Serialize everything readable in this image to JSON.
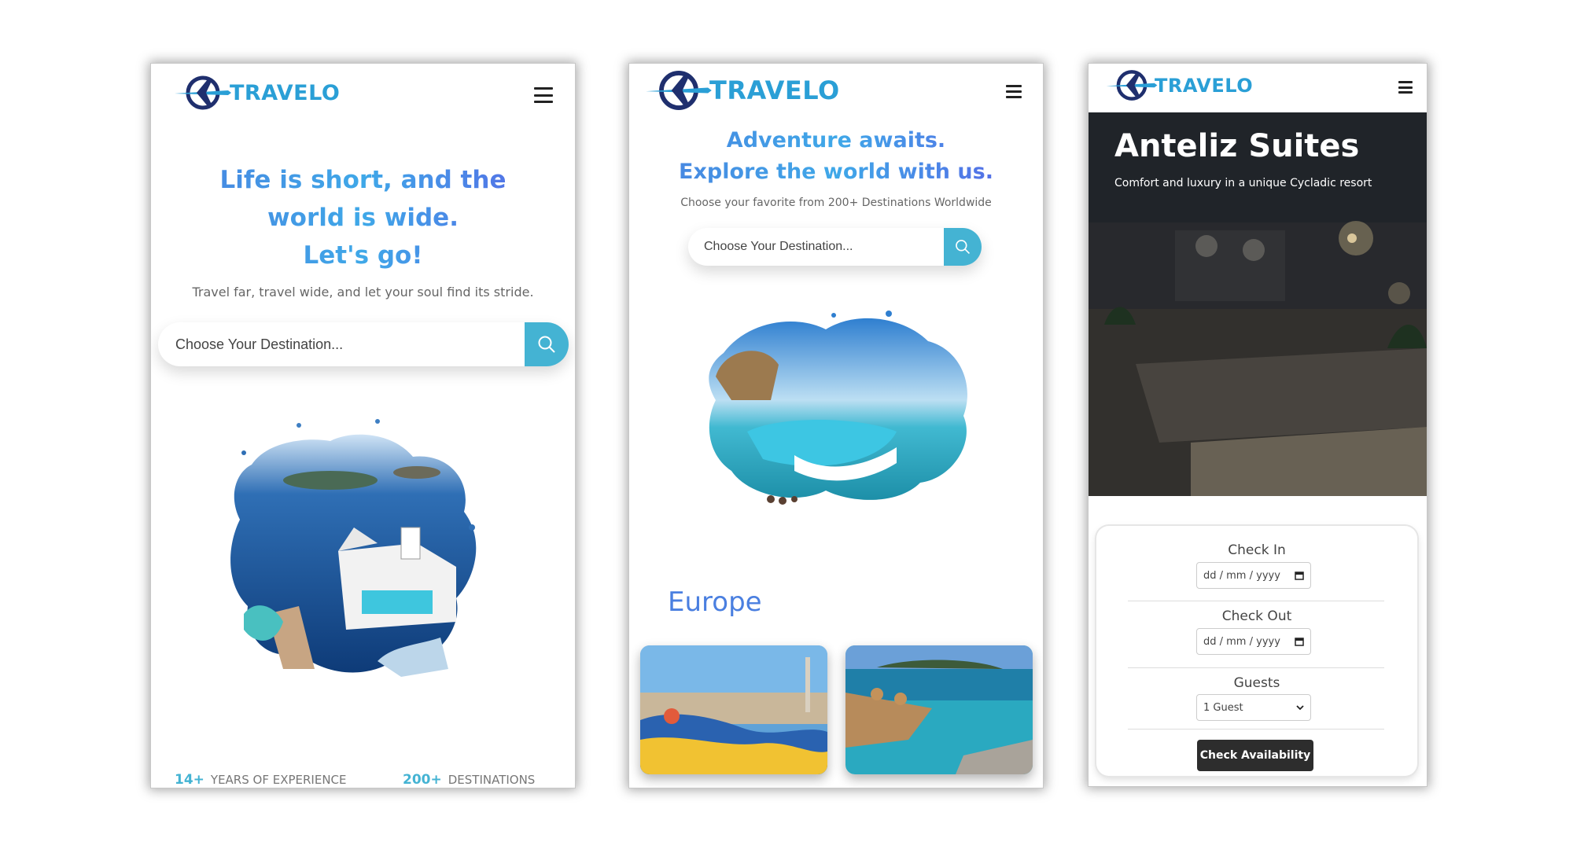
{
  "brand": {
    "name": "TRAVELO",
    "color": "#2a9fd6"
  },
  "colors": {
    "accent": "#44b3d3",
    "heading_gradient": [
      "#4a7fe0",
      "#3fa8e8",
      "#5a5fe6"
    ],
    "button_dark": "#2d2d2d"
  },
  "icons": {
    "menu": "hamburger-icon",
    "search": "search-icon",
    "logo": "plane-globe-logo",
    "calendar": "calendar-icon",
    "dropdown": "chevron-down-icon"
  },
  "screen1": {
    "headline_line1": "Life is short, and the",
    "headline_line2": "world is wide.",
    "headline_line3": "Let's go!",
    "subtitle": "Travel far, travel wide, and let your soul find its stride.",
    "search_placeholder": "Choose Your Destination...",
    "stats": [
      {
        "value": "14+",
        "label": "YEARS OF EXPERIENCE"
      },
      {
        "value": "200+",
        "label": "DESTINATIONS"
      }
    ]
  },
  "screen2": {
    "headline_line1": "Adventure awaits.",
    "headline_line2": "Explore the world with us.",
    "subtitle": "Choose your favorite from 200+ Destinations Worldwide",
    "search_placeholder": "Choose Your Destination...",
    "section_title": "Europe"
  },
  "screen3": {
    "hero_title": "Anteliz Suites",
    "hero_subtitle": "Comfort and luxury in a unique Cycladic resort",
    "check_in_label": "Check In",
    "check_in_value": "dd / mm / yyyy",
    "check_out_label": "Check Out",
    "check_out_value": "dd / mm / yyyy",
    "guests_label": "Guests",
    "guests_value": "1 Guest",
    "button_label": "Check Availability"
  }
}
